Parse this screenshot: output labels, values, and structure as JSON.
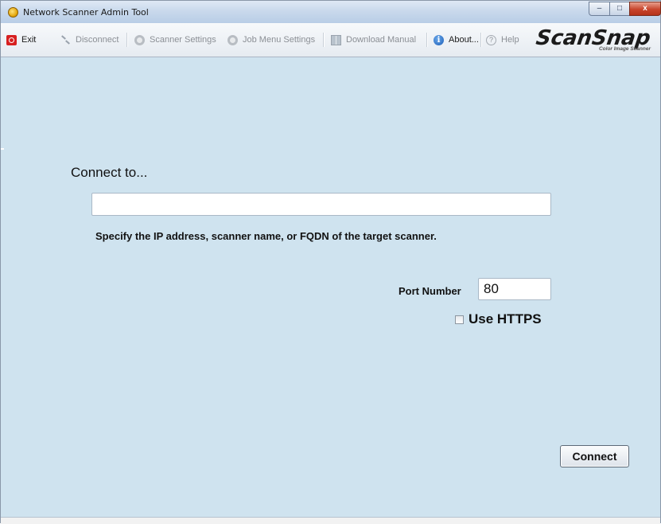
{
  "window": {
    "title": "Network Scanner Admin Tool",
    "controls": {
      "minimize": "–",
      "maximize": "□",
      "close": "x"
    }
  },
  "toolbar": {
    "items": [
      {
        "label": "Exit",
        "icon": "exit-icon",
        "enabled": true
      },
      {
        "label": "Disconnect",
        "icon": "disconnect-icon",
        "enabled": false
      },
      {
        "label": "Scanner Settings",
        "icon": "gear-icon",
        "enabled": false
      },
      {
        "label": "Job Menu Settings",
        "icon": "gear-icon",
        "enabled": false
      },
      {
        "label": "Download Manual",
        "icon": "book-icon",
        "enabled": false
      },
      {
        "label": "About...",
        "icon": "info-icon",
        "enabled": true
      },
      {
        "label": "Help",
        "icon": "help-icon",
        "enabled": false
      }
    ]
  },
  "brand": {
    "logo": "ScanSnap",
    "tagline": "Color Image Scanner"
  },
  "form": {
    "connect_label": "Connect to...",
    "host_value": "",
    "hint": "Specify the IP address, scanner name, or FQDN of the target scanner.",
    "port_label": "Port Number",
    "port_value": "80",
    "https_label": "Use HTTPS",
    "https_checked": false,
    "connect_button": "Connect"
  },
  "colors": {
    "background": "#cfe3ef",
    "exit_icon": "#d72020",
    "info_icon": "#1d5fb8"
  }
}
